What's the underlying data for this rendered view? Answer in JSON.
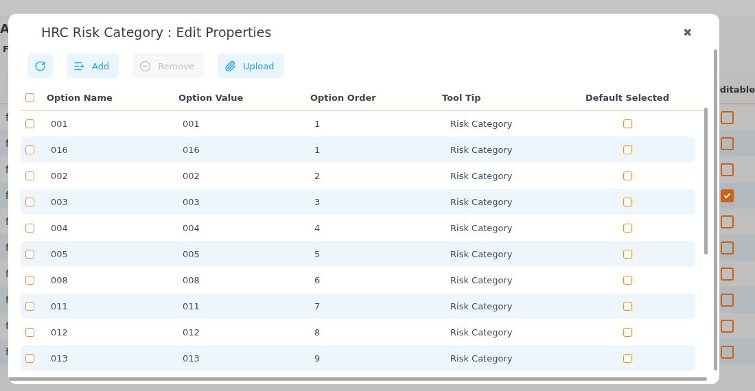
{
  "background": {
    "title": "A",
    "filter_label": "F",
    "column_header": "ditable",
    "rows": [
      {
        "text": "f",
        "checked": false
      },
      {
        "text": "f",
        "checked": false
      },
      {
        "text": "f",
        "checked": false
      },
      {
        "text": "f",
        "checked": true
      },
      {
        "text": "f",
        "checked": false
      },
      {
        "text": "f",
        "checked": false
      },
      {
        "text": "f",
        "checked": false
      },
      {
        "text": "f",
        "checked": false
      },
      {
        "text": "f",
        "checked": false
      },
      {
        "text": "f",
        "checked": false
      }
    ]
  },
  "dialog": {
    "title": "HRC Risk Category : Edit Properties",
    "close": "✖",
    "toolbar": [
      {
        "kind": "refresh",
        "disabled": false
      },
      {
        "kind": "add",
        "label": "Add",
        "disabled": false
      },
      {
        "kind": "remove",
        "label": "Remove",
        "disabled": true
      },
      {
        "kind": "upload",
        "label": "Upload",
        "disabled": false
      }
    ],
    "table": {
      "select_all": false,
      "columns": [
        "Option Name",
        "Option Value",
        "Option Order",
        "Tool Tip",
        "Default Selected"
      ],
      "rows": [
        {
          "selected": false,
          "name": "001",
          "value": "001",
          "order": "1",
          "tooltip": "Risk Category",
          "default": false
        },
        {
          "selected": false,
          "name": "016",
          "value": "016",
          "order": "1",
          "tooltip": "Risk Category",
          "default": false
        },
        {
          "selected": false,
          "name": "002",
          "value": "002",
          "order": "2",
          "tooltip": "Risk Category",
          "default": false
        },
        {
          "selected": false,
          "name": "003",
          "value": "003",
          "order": "3",
          "tooltip": "Risk Category",
          "default": false
        },
        {
          "selected": false,
          "name": "004",
          "value": "004",
          "order": "4",
          "tooltip": "Risk Category",
          "default": false
        },
        {
          "selected": false,
          "name": "005",
          "value": "005",
          "order": "5",
          "tooltip": "Risk Category",
          "default": false
        },
        {
          "selected": false,
          "name": "008",
          "value": "008",
          "order": "6",
          "tooltip": "Risk Category",
          "default": false
        },
        {
          "selected": false,
          "name": "011",
          "value": "011",
          "order": "7",
          "tooltip": "Risk Category",
          "default": false
        },
        {
          "selected": false,
          "name": "012",
          "value": "012",
          "order": "8",
          "tooltip": "Risk Category",
          "default": false
        },
        {
          "selected": false,
          "name": "013",
          "value": "013",
          "order": "9",
          "tooltip": "Risk Category",
          "default": false
        }
      ]
    }
  }
}
